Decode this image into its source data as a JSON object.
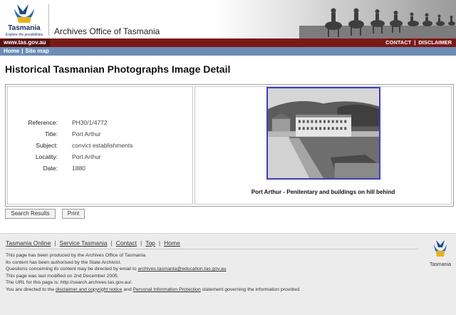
{
  "header": {
    "logo_text": "Tasmania",
    "logo_tagline": "Explore the possibilities",
    "site_title": "Archives Office of Tasmania"
  },
  "topbar": {
    "url": "www.tas.gov.au",
    "contact": "CONTACT",
    "disclaimer": "DISCLAIMER"
  },
  "nav": {
    "home": "Home",
    "site_map": "Site map"
  },
  "page": {
    "heading": "Historical Tasmanian Photographs Image Detail"
  },
  "record": {
    "fields": [
      {
        "label": "Reference:",
        "value": "PH30/1/4772"
      },
      {
        "label": "Title:",
        "value": "Port Arthur"
      },
      {
        "label": "Subject:",
        "value": "convict establishments"
      },
      {
        "label": "Locality:",
        "value": "Port Arthur"
      },
      {
        "label": "Date:",
        "value": "1880"
      }
    ],
    "caption": "Port Arthur - Penitentary and buildings on hill behind"
  },
  "buttons": {
    "search_results": "Search Results",
    "print": "Print"
  },
  "footer": {
    "links": [
      "Tasmania Online",
      "Service Tasmania",
      "Contact",
      "Top",
      "Home"
    ],
    "line1": "This page has been produced by the Archives Office of Tasmania.",
    "line2": "Its content has been authorised by the State Archivist.",
    "line3_prefix": "Questions concerning its content may be directed by email to ",
    "line3_email": "archives.tasmania@education.tas.gov.au",
    "line4": "This page was last modified on 2nd December 2005.",
    "line5": "The URL for this page is: http://search.archives.tas.gov.au/.",
    "line6_prefix": "You are directed to the ",
    "line6_link1": "disclaimer and copyright notice",
    "line6_mid": " and ",
    "line6_link2": "Personal Information Protection",
    "line6_suffix": " statement governing the information provided.",
    "logo_text": "Tasmania"
  },
  "colors": {
    "red_bar": "#7a1a17",
    "blue_bar": "#6c8cb6",
    "photo_border": "#3f3fbf"
  }
}
